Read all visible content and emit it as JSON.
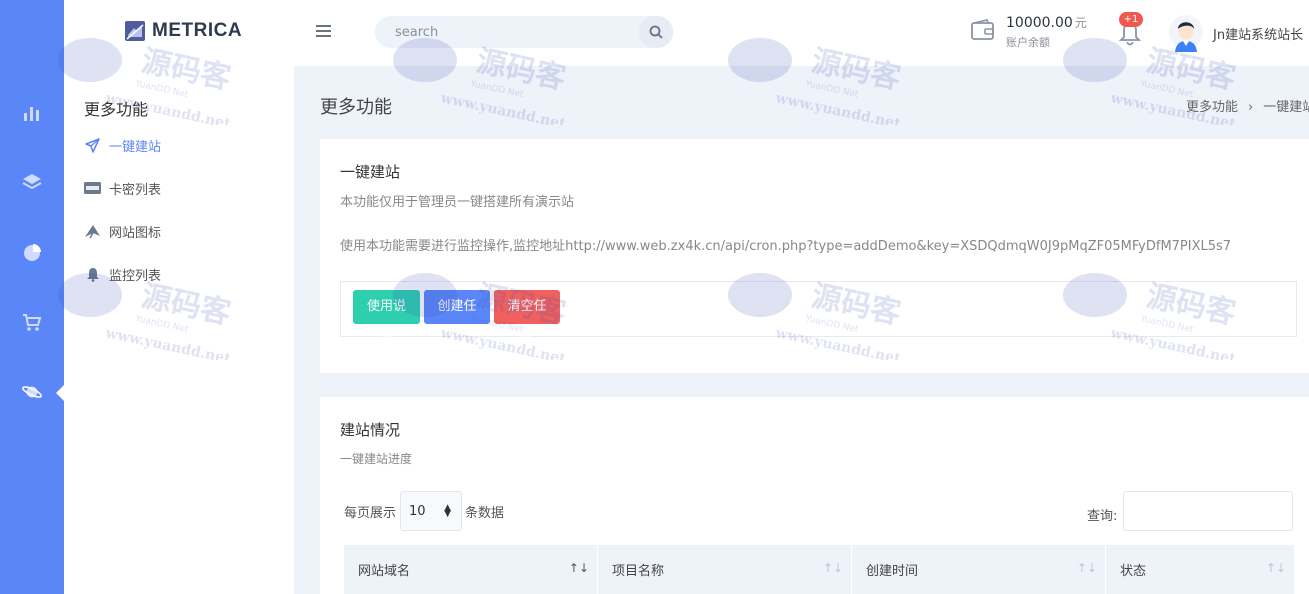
{
  "header": {
    "logo_text": "METRICA",
    "search_placeholder": "search",
    "balance_amount": "10000.00",
    "balance_unit": "元",
    "balance_label": "账户余额",
    "notification_badge": "+1",
    "username": "Jn建站系统站长"
  },
  "rail": {
    "items": [
      "bar-chart-icon",
      "layers-icon",
      "pie-chart-icon",
      "cart-icon",
      "planet-icon"
    ],
    "active_index": 4
  },
  "subnav": {
    "title": "更多功能",
    "items": [
      {
        "label": "一键建站",
        "icon": "send-icon",
        "active": true
      },
      {
        "label": "卡密列表",
        "icon": "visa-card-icon",
        "active": false
      },
      {
        "label": "网站图标",
        "icon": "paper-plane-icon",
        "active": false
      },
      {
        "label": "监控列表",
        "icon": "bell-icon",
        "active": false
      }
    ]
  },
  "main": {
    "page_title": "更多功能",
    "breadcrumb": [
      "更多功能",
      "一键建站"
    ]
  },
  "card1": {
    "title": "一键建站",
    "description": "本功能仅用于管理员一键搭建所有演示站",
    "info": "使用本功能需要进行监控操作,监控地址http://www.web.zx4k.cn/api/cron.php?type=addDemo&key=XSDQdmqW0J9pMqZF05MFyDfM7PIXL5s7",
    "buttons": {
      "help": "使用说明",
      "create": "创建任务",
      "clear": "清空任务"
    }
  },
  "card2": {
    "title": "建站情况",
    "description": "一键建站进度",
    "length_prefix": "每页展示",
    "length_value": "10",
    "length_suffix": "条数据",
    "query_label": "查询:",
    "columns": [
      "网站域名",
      "项目名称",
      "创建时间",
      "状态"
    ]
  },
  "watermark": {
    "title": "源码客",
    "sub": "YuanDD Net",
    "url": "www.yuandd.net"
  },
  "colors": {
    "rail": "#5b86f7",
    "accent": "#5b86f7",
    "teal": "#2dcfae",
    "red": "#f0605f",
    "badge": "#f0584f",
    "background": "#eef2f9"
  }
}
